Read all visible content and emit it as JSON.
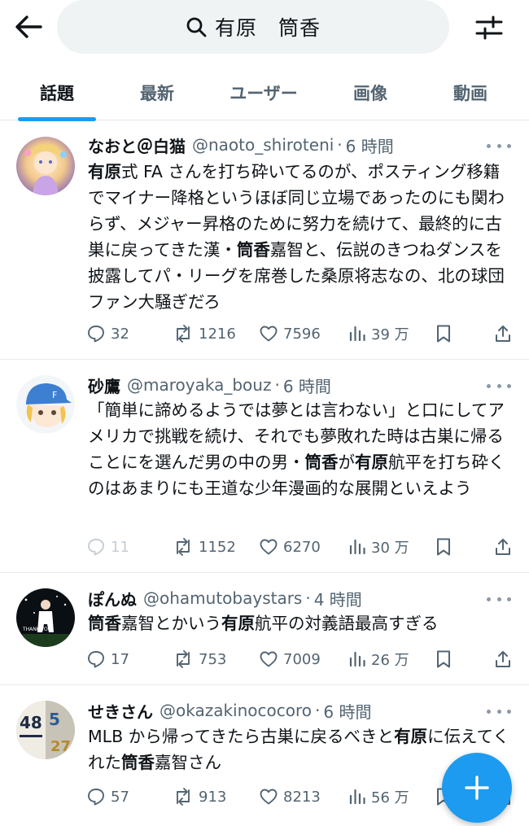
{
  "search": {
    "query": "有原　筒香"
  },
  "tabs": [
    {
      "label": "話題",
      "active": true
    },
    {
      "label": "最新",
      "active": false
    },
    {
      "label": "ユーザー",
      "active": false
    },
    {
      "label": "画像",
      "active": false
    },
    {
      "label": "動画",
      "active": false
    }
  ],
  "posts": [
    {
      "name": "なおと＠白猫",
      "handle": "@naoto_shiroteni",
      "time": "6 時間",
      "body_segments": [
        {
          "text": "有原",
          "bold": true
        },
        {
          "text": "式 FA さんを打ち砕いてるのが、ポスティング移籍でマイナー降格というほぼ同じ立場であったのにも関わらず、メジャー昇格のために努力を続けて、最終的に古巣に戻ってきた漢・",
          "bold": false
        },
        {
          "text": "筒香",
          "bold": true
        },
        {
          "text": "嘉智と、伝説のきつねダンスを披露してパ・リーグを席巻した桑原将志なの、北の球団ファン大騒ぎだろ",
          "bold": false
        }
      ],
      "replies": "32",
      "reposts": "1216",
      "likes": "7596",
      "views": "39 万"
    },
    {
      "name": "砂鷹",
      "handle": "@maroyaka_bouz",
      "time": "6 時間",
      "body_segments": [
        {
          "text": "「簡単に諦めるようでは夢とは言わない」と口にしてアメリカで挑戦を続け、それでも夢敗れた時は古巣に帰ることにを選んだ男の中の男・",
          "bold": false
        },
        {
          "text": "筒香",
          "bold": true
        },
        {
          "text": "が",
          "bold": false
        },
        {
          "text": "有原",
          "bold": true
        },
        {
          "text": "航平を打ち砕くのはあまりにも王道な少年漫画的な展開といえよう",
          "bold": false
        }
      ],
      "replies": "11",
      "reposts": "1152",
      "likes": "6270",
      "views": "30 万"
    },
    {
      "name": "ぽんぬ",
      "handle": "@ohamutobaystars",
      "time": "4 時間",
      "body_segments": [
        {
          "text": "筒香",
          "bold": true
        },
        {
          "text": "嘉智とかいう",
          "bold": false
        },
        {
          "text": "有原",
          "bold": true
        },
        {
          "text": "航平の対義語最高すぎる",
          "bold": false
        }
      ],
      "replies": "17",
      "reposts": "753",
      "likes": "7009",
      "views": "26 万"
    },
    {
      "name": "せきさん",
      "handle": "@okazakinococoro",
      "time": "6 時間",
      "body_segments": [
        {
          "text": "MLB から帰ってきたら古巣に戻るべきと",
          "bold": false
        },
        {
          "text": "有原",
          "bold": true
        },
        {
          "text": "に伝えてくれた",
          "bold": false
        },
        {
          "text": "筒香",
          "bold": true
        },
        {
          "text": "嘉智さん",
          "bold": false
        }
      ],
      "replies": "57",
      "reposts": "913",
      "likes": "8213",
      "views": "56 万"
    }
  ],
  "icons": {
    "back": "arrow-left-icon",
    "search": "search-icon",
    "filter": "sliders-icon",
    "reply": "speech-bubble-icon",
    "repost": "repost-arrows-icon",
    "like": "heart-icon",
    "views": "bar-chart-icon",
    "bookmark": "bookmark-icon",
    "share": "share-icon",
    "compose": "plus-icon"
  },
  "colors": {
    "accent": "#1d9bf0",
    "text_primary": "#0f1419",
    "text_secondary": "#536471",
    "search_bg": "#eff3f4"
  }
}
